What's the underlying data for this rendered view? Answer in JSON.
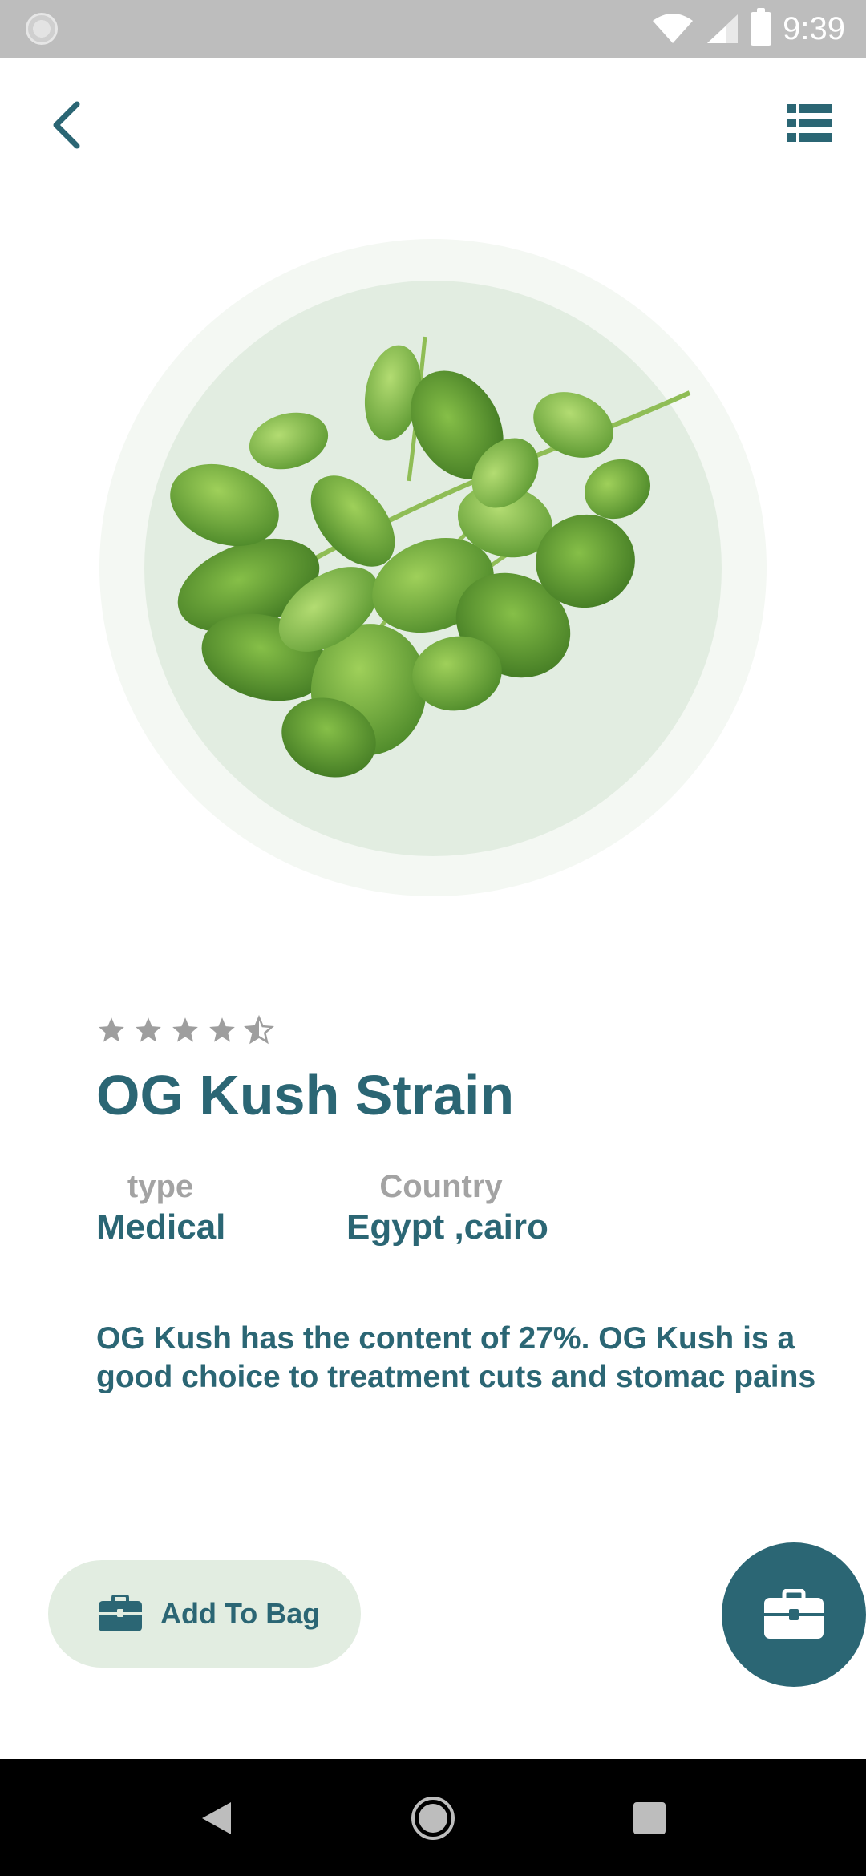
{
  "status_bar": {
    "time": "9:39",
    "icons": [
      "wifi-icon",
      "signal-icon",
      "battery-icon"
    ]
  },
  "toolbar": {
    "back_icon": "chevron-left-icon",
    "menu_icon": "list-icon"
  },
  "product": {
    "image": "herb-leaves-image",
    "rating": 4.5,
    "rating_max": 5,
    "name": "OG Kush Strain",
    "type_label": "type",
    "type_value": "Medical",
    "country_label": "Country",
    "country_value": "Egypt ,cairo",
    "description": "OG Kush has the content of 27%. OG Kush is a good choice to treatment cuts and stomac pains"
  },
  "actions": {
    "add_to_bag_label": "Add To Bag",
    "add_to_bag_icon": "briefcase-icon",
    "fab_icon": "briefcase-icon"
  },
  "colors": {
    "primary": "#2b6674",
    "light_green": "#e2ede1",
    "pale_green": "#f4f8f3",
    "muted_text": "#a3a3a3",
    "star": "#9e9e9e"
  },
  "nav_bar": {
    "icons": [
      "nav-back-icon",
      "nav-home-icon",
      "nav-recents-icon"
    ]
  }
}
